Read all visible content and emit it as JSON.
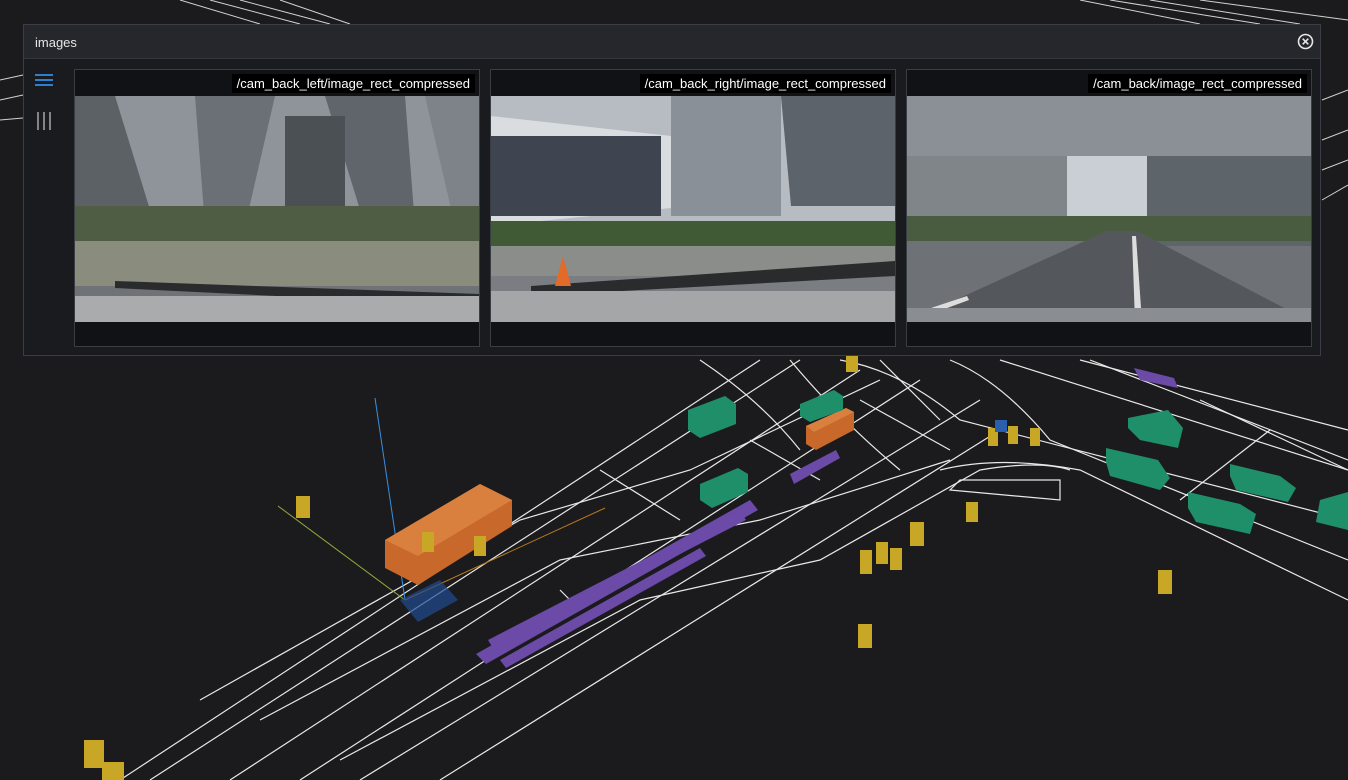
{
  "panel": {
    "title": "images",
    "close_icon": "close-circle-icon",
    "menu_icon": "hamburger-menu-icon",
    "layout_icon": "columns-layout-icon",
    "accent_color": "#2d7fd0"
  },
  "cameras": [
    {
      "topic": "/cam_back_left/image_rect_compressed"
    },
    {
      "topic": "/cam_back_right/image_rect_compressed"
    },
    {
      "topic": "/cam_back/image_rect_compressed"
    }
  ],
  "scene": {
    "background": "#1b1b1d",
    "lane_color": "#ffffff",
    "object_colors": {
      "car": "#1f8f6a",
      "truck": "#c8682a",
      "pedestrian": "#c9a726",
      "barrier": "#6b4aa8",
      "bicycle": "#2a5fb0"
    }
  }
}
